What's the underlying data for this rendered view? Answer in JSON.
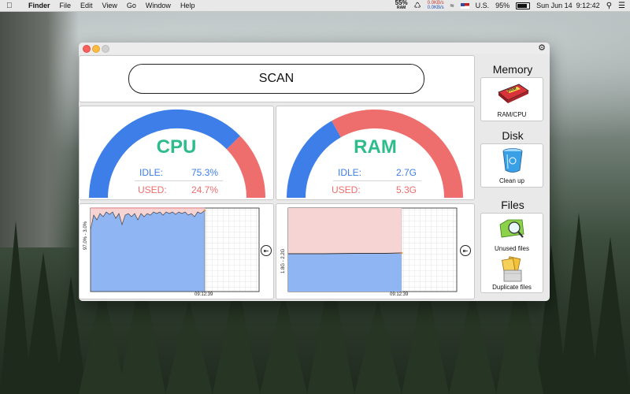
{
  "menubar": {
    "app": "Finder",
    "menus": [
      "File",
      "Edit",
      "View",
      "Go",
      "Window",
      "Help"
    ],
    "ram_percent": "55%",
    "ram_label": "RAM",
    "net_up": "0.0KB/s",
    "net_down": "0.0KB/s",
    "input_source": "U.S.",
    "battery": "95%",
    "datetime": "Sun Jun 14  9:12:42"
  },
  "scan": {
    "label": "SCAN"
  },
  "cpu": {
    "title": "CPU",
    "idle_label": "IDLE:",
    "idle_value": "75.3%",
    "used_label": "USED:",
    "used_value": "24.7%",
    "used_fraction": 0.247,
    "graph_ylabel": "97.0% - 3.0%",
    "graph_time": "09:12:39"
  },
  "ram": {
    "title": "RAM",
    "idle_label": "IDLE:",
    "idle_value": "2.7G",
    "used_label": "USED:",
    "used_value": "5.3G",
    "used_fraction": 0.663,
    "graph_ylabel": "1.8G - 2.2G",
    "graph_time": "09:12:39"
  },
  "sidebar": {
    "memory_header": "Memory",
    "ramcpu_label": "RAM/CPU",
    "disk_header": "Disk",
    "cleanup_label": "Clean up",
    "files_header": "Files",
    "unused_label": "Unused files",
    "duplicate_label": "Duplicate files"
  },
  "colors": {
    "idle": "#3d7ee8",
    "used": "#ee6d6d",
    "title": "#2ebc8b"
  }
}
